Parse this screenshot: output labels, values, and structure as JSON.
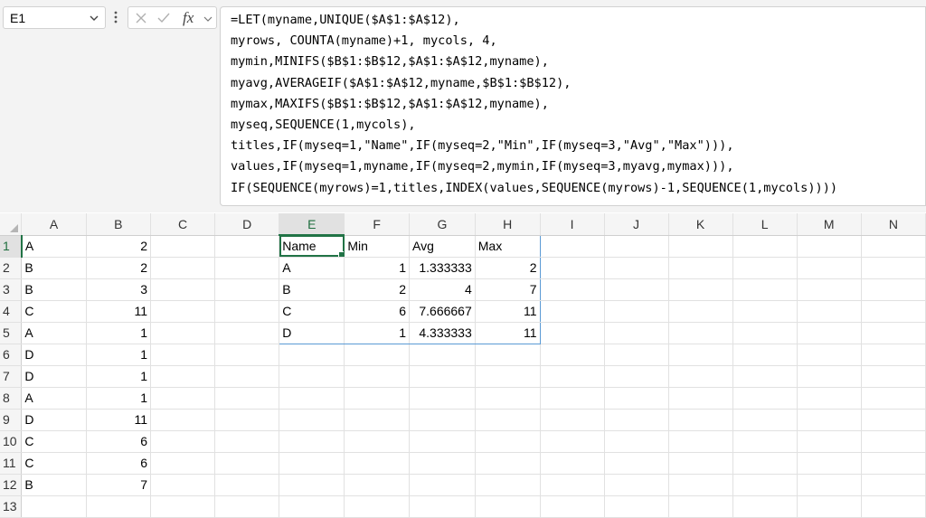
{
  "name_box": {
    "value": "E1"
  },
  "formula_bar": {
    "fx_label": "fx",
    "lines": [
      "=LET(myname,UNIQUE($A$1:$A$12),",
      "myrows, COUNTA(myname)+1, mycols, 4,",
      "mymin,MINIFS($B$1:$B$12,$A$1:$A$12,myname),",
      "myavg,AVERAGEIF($A$1:$A$12,myname,$B$1:$B$12),",
      "mymax,MAXIFS($B$1:$B$12,$A$1:$A$12,myname),",
      "myseq,SEQUENCE(1,mycols),",
      "titles,IF(myseq=1,\"Name\",IF(myseq=2,\"Min\",IF(myseq=3,\"Avg\",\"Max\"))),",
      "values,IF(myseq=1,myname,IF(myseq=2,mymin,IF(myseq=3,myavg,mymax))),",
      "IF(SEQUENCE(myrows)=1,titles,INDEX(values,SEQUENCE(myrows)-1,SEQUENCE(1,mycols))))"
    ]
  },
  "columns": [
    "A",
    "B",
    "C",
    "D",
    "E",
    "F",
    "G",
    "H",
    "I",
    "J",
    "K",
    "L",
    "M",
    "N"
  ],
  "rows": [
    {
      "num": "1",
      "A": "A",
      "B": "2",
      "E": "Name",
      "F": "Min",
      "G": "Avg",
      "H": "Max"
    },
    {
      "num": "2",
      "A": "B",
      "B": "2",
      "E": "A",
      "F": "1",
      "G": "1.333333",
      "H": "2"
    },
    {
      "num": "3",
      "A": "B",
      "B": "3",
      "E": "B",
      "F": "2",
      "G": "4",
      "H": "7"
    },
    {
      "num": "4",
      "A": "C",
      "B": "11",
      "E": "C",
      "F": "6",
      "G": "7.666667",
      "H": "11"
    },
    {
      "num": "5",
      "A": "A",
      "B": "1",
      "E": "D",
      "F": "1",
      "G": "4.333333",
      "H": "11"
    },
    {
      "num": "6",
      "A": "D",
      "B": "1"
    },
    {
      "num": "7",
      "A": "D",
      "B": "1"
    },
    {
      "num": "8",
      "A": "A",
      "B": "1"
    },
    {
      "num": "9",
      "A": "D",
      "B": "11"
    },
    {
      "num": "10",
      "A": "C",
      "B": "6"
    },
    {
      "num": "11",
      "A": "C",
      "B": "6"
    },
    {
      "num": "12",
      "A": "B",
      "B": "7"
    },
    {
      "num": "13"
    }
  ],
  "active_cell": "E1",
  "colors": {
    "selection": "#217346",
    "spill_border": "#5b9bd5"
  }
}
